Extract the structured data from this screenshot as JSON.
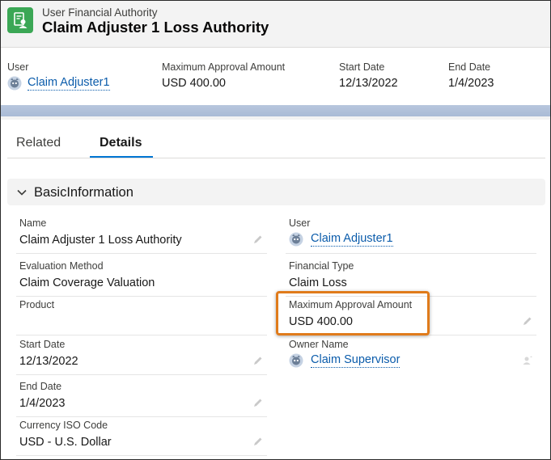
{
  "header": {
    "object_label": "User Financial Authority",
    "title": "Claim Adjuster 1 Loss Authority",
    "icon": "user-financial-authority-icon"
  },
  "highlights": {
    "user_label": "User",
    "user_value": "Claim Adjuster1",
    "max_amount_label": "Maximum Approval Amount",
    "max_amount_value": "USD 400.00",
    "start_label": "Start Date",
    "start_value": "12/13/2022",
    "end_label": "End Date",
    "end_value": "1/4/2023"
  },
  "tabs": [
    {
      "label": "Related",
      "active": false
    },
    {
      "label": "Details",
      "active": true
    }
  ],
  "section": {
    "title": "BasicInformation",
    "expanded": true
  },
  "fields_left": [
    {
      "label": "Name",
      "value": "Claim Adjuster 1 Loss Authority",
      "editable": true
    },
    {
      "label": "Evaluation Method",
      "value": "Claim Coverage Valuation",
      "editable": false
    },
    {
      "label": "Product",
      "value": "",
      "editable": false
    },
    {
      "label": "Start Date",
      "value": "12/13/2022",
      "editable": true
    },
    {
      "label": "End Date",
      "value": "1/4/2023",
      "editable": true
    },
    {
      "label": "Currency ISO Code",
      "value": "USD - U.S. Dollar",
      "editable": true
    }
  ],
  "fields_right": [
    {
      "label": "User",
      "value": "Claim Adjuster1",
      "link": true
    },
    {
      "label": "Financial Type",
      "value": "Claim Loss",
      "editable": false
    },
    {
      "label": "Maximum Approval Amount",
      "value": "USD 400.00",
      "editable": true
    },
    {
      "label": "Owner Name",
      "value": "Claim Supervisor",
      "link": true
    }
  ],
  "colors": {
    "accent": "#0176d3",
    "link": "#0b5cab",
    "object_icon": "#3ba755",
    "highlight_box": "#e07b1b"
  }
}
